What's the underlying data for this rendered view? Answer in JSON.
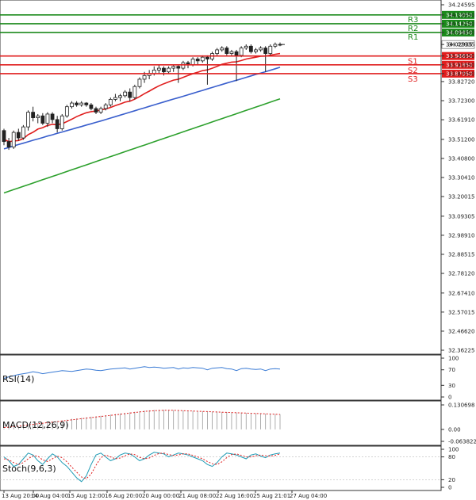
{
  "chart_data": {
    "type": "candlestick",
    "y_ticks": [
      "34.24595",
      "34.19050",
      "34.14250",
      "34.09450",
      "34.02935",
      "33.96650",
      "33.91850",
      "33.87050",
      "33.82720",
      "33.72300",
      "33.61910",
      "33.51200",
      "33.40800",
      "33.30410",
      "33.20015",
      "33.09305",
      "32.98910",
      "32.88515",
      "32.78120",
      "32.67410",
      "32.57015",
      "32.46620",
      "32.36225"
    ],
    "ylim": [
      32.36225,
      34.24595
    ],
    "x_ticks": [
      "13 Aug 20:00",
      "14 Aug 04:00",
      "15 Aug 12:00",
      "16 Aug 20:00",
      "20 Aug 00:00",
      "21 Aug 08:00",
      "22 Aug 16:00",
      "25 Aug 21:01",
      "27 Aug 04:00"
    ],
    "current_price": {
      "label": "34.02935",
      "value": 34.02935
    },
    "levels": [
      {
        "name": "R3",
        "value": 34.1905,
        "label": "34.19050",
        "color": "#1b8a1b"
      },
      {
        "name": "R2",
        "value": 34.1425,
        "label": "34.14250",
        "color": "#1b8a1b"
      },
      {
        "name": "R1",
        "value": 34.0945,
        "label": "34.09450",
        "color": "#1b8a1b"
      },
      {
        "name": "S1",
        "value": 33.9665,
        "label": "33.96650",
        "color": "#e01e1e"
      },
      {
        "name": "S2",
        "value": 33.9185,
        "label": "33.91850",
        "color": "#e01e1e"
      },
      {
        "name": "S3",
        "value": 33.8705,
        "label": "33.87050",
        "color": "#e01e1e"
      }
    ],
    "candles": [
      [
        33.56,
        33.5,
        33.48,
        33.57
      ],
      [
        33.5,
        33.47,
        33.455,
        33.52
      ],
      [
        33.47,
        33.55,
        33.46,
        33.56
      ],
      [
        33.55,
        33.52,
        33.505,
        33.57
      ],
      [
        33.52,
        33.58,
        33.51,
        33.59
      ],
      [
        33.58,
        33.66,
        33.56,
        33.67
      ],
      [
        33.66,
        33.63,
        33.61,
        33.69
      ],
      [
        33.63,
        33.64,
        33.6,
        33.65
      ],
      [
        33.64,
        33.6,
        33.59,
        33.655
      ],
      [
        33.6,
        33.65,
        33.58,
        33.66
      ],
      [
        33.65,
        33.62,
        33.6,
        33.66
      ],
      [
        33.62,
        33.57,
        33.55,
        33.64
      ],
      [
        33.57,
        33.64,
        33.56,
        33.65
      ],
      [
        33.64,
        33.69,
        33.63,
        33.7
      ],
      [
        33.69,
        33.71,
        33.68,
        33.72
      ],
      [
        33.71,
        33.7,
        33.69,
        33.72
      ],
      [
        33.7,
        33.71,
        33.69,
        33.72
      ],
      [
        33.71,
        33.7,
        33.69,
        33.715
      ],
      [
        33.7,
        33.68,
        33.67,
        33.71
      ],
      [
        33.68,
        33.66,
        33.65,
        33.69
      ],
      [
        33.66,
        33.68,
        33.65,
        33.69
      ],
      [
        33.68,
        33.7,
        33.67,
        33.71
      ],
      [
        33.7,
        33.73,
        33.69,
        33.74
      ],
      [
        33.73,
        33.74,
        33.72,
        33.76
      ],
      [
        33.74,
        33.75,
        33.72,
        33.76
      ],
      [
        33.75,
        33.77,
        33.74,
        33.78
      ],
      [
        33.77,
        33.74,
        33.72,
        33.79
      ],
      [
        33.74,
        33.8,
        33.73,
        33.81
      ],
      [
        33.8,
        33.84,
        33.79,
        33.85
      ],
      [
        33.84,
        33.86,
        33.82,
        33.88
      ],
      [
        33.86,
        33.87,
        33.84,
        33.89
      ],
      [
        33.87,
        33.89,
        33.86,
        33.91
      ],
      [
        33.89,
        33.9,
        33.87,
        33.92
      ],
      [
        33.9,
        33.88,
        33.86,
        33.91
      ],
      [
        33.88,
        33.9,
        33.87,
        33.91
      ],
      [
        33.9,
        33.91,
        33.88,
        33.92
      ],
      [
        33.91,
        33.9,
        33.82,
        33.915
      ],
      [
        33.9,
        33.93,
        33.89,
        33.94
      ],
      [
        33.93,
        33.92,
        33.9,
        33.94
      ],
      [
        33.92,
        33.95,
        33.91,
        33.96
      ],
      [
        33.95,
        33.94,
        33.92,
        33.96
      ],
      [
        33.94,
        33.96,
        33.93,
        33.97
      ],
      [
        33.96,
        33.95,
        33.81,
        33.97
      ],
      [
        33.95,
        33.98,
        33.94,
        33.99
      ],
      [
        33.98,
        34.0,
        33.97,
        34.01
      ],
      [
        34.0,
        34.01,
        33.99,
        34.02
      ],
      [
        34.01,
        33.98,
        33.97,
        34.02
      ],
      [
        33.98,
        33.99,
        33.97,
        34.0
      ],
      [
        33.99,
        33.97,
        33.83,
        34.0
      ],
      [
        33.97,
        34.01,
        33.96,
        34.02
      ],
      [
        34.01,
        34.02,
        34.0,
        34.03
      ],
      [
        34.02,
        33.99,
        33.98,
        34.03
      ],
      [
        33.99,
        34.0,
        33.98,
        34.01
      ],
      [
        34.0,
        34.01,
        33.99,
        34.02
      ],
      [
        34.01,
        33.98,
        33.88,
        34.02
      ],
      [
        33.98,
        34.02,
        33.97,
        34.03
      ],
      [
        34.02,
        34.03,
        34.01,
        34.04
      ],
      [
        34.03,
        34.029,
        34.02,
        34.04
      ]
    ],
    "ma_red": [
      33.512,
      33.5,
      33.503,
      33.506,
      33.516,
      33.538,
      33.551,
      33.568,
      33.576,
      33.588,
      33.594,
      33.592,
      33.597,
      33.609,
      33.622,
      33.636,
      33.647,
      33.657,
      33.663,
      33.667,
      33.672,
      33.678,
      33.686,
      33.696,
      33.705,
      33.715,
      33.72,
      33.731,
      33.745,
      33.761,
      33.775,
      33.79,
      33.804,
      33.815,
      33.825,
      33.835,
      33.84,
      33.85,
      33.86,
      33.87,
      33.878,
      33.887,
      33.891,
      33.9,
      33.91,
      33.921,
      33.927,
      33.933,
      33.935,
      33.942,
      33.95,
      33.955,
      33.96,
      33.965,
      33.966,
      33.971,
      33.976,
      33.98
    ],
    "ma_blue": [
      33.46,
      33.468,
      33.476,
      33.484,
      33.491,
      33.499,
      33.507,
      33.514,
      33.522,
      33.53,
      33.537,
      33.545,
      33.552,
      33.56,
      33.567,
      33.575,
      33.582,
      33.59,
      33.597,
      33.605,
      33.612,
      33.62,
      33.628,
      33.636,
      33.644,
      33.652,
      33.66,
      33.668,
      33.676,
      33.684,
      33.692,
      33.7,
      33.708,
      33.716,
      33.724,
      33.732,
      33.739,
      33.747,
      33.755,
      33.763,
      33.771,
      33.779,
      33.787,
      33.795,
      33.803,
      33.811,
      33.819,
      33.827,
      33.834,
      33.842,
      33.85,
      33.858,
      33.866,
      33.873,
      33.881,
      33.889,
      33.897,
      33.905
    ],
    "ma_green": [
      33.22,
      33.229,
      33.238,
      33.247,
      33.256,
      33.265,
      33.274,
      33.283,
      33.292,
      33.301,
      33.31,
      33.319,
      33.328,
      33.337,
      33.346,
      33.355,
      33.364,
      33.373,
      33.382,
      33.391,
      33.4,
      33.409,
      33.418,
      33.427,
      33.436,
      33.445,
      33.454,
      33.463,
      33.472,
      33.481,
      33.49,
      33.499,
      33.508,
      33.517,
      33.526,
      33.535,
      33.544,
      33.553,
      33.562,
      33.571,
      33.58,
      33.589,
      33.598,
      33.607,
      33.616,
      33.625,
      33.634,
      33.643,
      33.652,
      33.661,
      33.67,
      33.679,
      33.688,
      33.697,
      33.706,
      33.715,
      33.724,
      33.733
    ],
    "rsi": {
      "label": "RSI(14)",
      "ticks": [
        "100",
        "70",
        "30",
        "0"
      ],
      "values": [
        48,
        52,
        55,
        58,
        60,
        62,
        65,
        63,
        60,
        62,
        64,
        66,
        68,
        67,
        66,
        68,
        70,
        72,
        71,
        69,
        68,
        70,
        72,
        73,
        74,
        75,
        72,
        74,
        76,
        78,
        76,
        77,
        76,
        74,
        75,
        76,
        72,
        75,
        74,
        76,
        75,
        74,
        70,
        74,
        75,
        76,
        73,
        72,
        68,
        73,
        74,
        72,
        71,
        72,
        68,
        72,
        73,
        72
      ]
    },
    "macd": {
      "label": "MACD(12,26,9)",
      "ticks": [
        "0.130698",
        "0.00",
        "-0.063822"
      ],
      "values": [
        0.005,
        0.008,
        0.012,
        0.016,
        0.02,
        0.024,
        0.028,
        0.032,
        0.036,
        0.04,
        0.043,
        0.046,
        0.05,
        0.053,
        0.056,
        0.059,
        0.062,
        0.065,
        0.068,
        0.07,
        0.073,
        0.076,
        0.079,
        0.082,
        0.085,
        0.088,
        0.091,
        0.094,
        0.097,
        0.1,
        0.102,
        0.104,
        0.105,
        0.105,
        0.104,
        0.103,
        0.102,
        0.101,
        0.1,
        0.099,
        0.098,
        0.097,
        0.096,
        0.095,
        0.094,
        0.093,
        0.092,
        0.091,
        0.09,
        0.089,
        0.088,
        0.087,
        0.086,
        0.085,
        0.084,
        0.083,
        0.082,
        0.081
      ],
      "signal": [
        0.01,
        0.012,
        0.015,
        0.018,
        0.021,
        0.024,
        0.027,
        0.03,
        0.033,
        0.036,
        0.039,
        0.042,
        0.045,
        0.048,
        0.051,
        0.054,
        0.057,
        0.06,
        0.063,
        0.066,
        0.069,
        0.072,
        0.075,
        0.078,
        0.081,
        0.084,
        0.087,
        0.09,
        0.093,
        0.096,
        0.098,
        0.1,
        0.101,
        0.102,
        0.102,
        0.102,
        0.101,
        0.1,
        0.099,
        0.098,
        0.097,
        0.096,
        0.095,
        0.094,
        0.093,
        0.092,
        0.091,
        0.09,
        0.089,
        0.088,
        0.087,
        0.086,
        0.085,
        0.084,
        0.083,
        0.082,
        0.081,
        0.08
      ]
    },
    "stoch": {
      "label": "Stoch(9,6,3)",
      "ticks": [
        "100",
        "80",
        "20",
        "0"
      ],
      "k": [
        80,
        70,
        55,
        60,
        75,
        90,
        85,
        70,
        60,
        75,
        88,
        80,
        65,
        55,
        40,
        25,
        15,
        30,
        60,
        85,
        90,
        80,
        70,
        75,
        85,
        90,
        88,
        80,
        70,
        75,
        85,
        92,
        90,
        88,
        80,
        85,
        90,
        88,
        85,
        80,
        75,
        70,
        60,
        55,
        65,
        80,
        90,
        88,
        85,
        80,
        75,
        85,
        88,
        82,
        78,
        85,
        88,
        90
      ],
      "d": [
        75,
        72,
        65,
        60,
        65,
        75,
        83,
        82,
        72,
        68,
        75,
        82,
        78,
        67,
        53,
        40,
        27,
        23,
        35,
        58,
        78,
        85,
        80,
        75,
        77,
        83,
        88,
        86,
        79,
        75,
        77,
        84,
        89,
        90,
        86,
        84,
        85,
        88,
        88,
        84,
        80,
        75,
        68,
        62,
        60,
        67,
        78,
        86,
        88,
        84,
        80,
        80,
        83,
        85,
        83,
        82,
        84,
        88
      ]
    }
  }
}
